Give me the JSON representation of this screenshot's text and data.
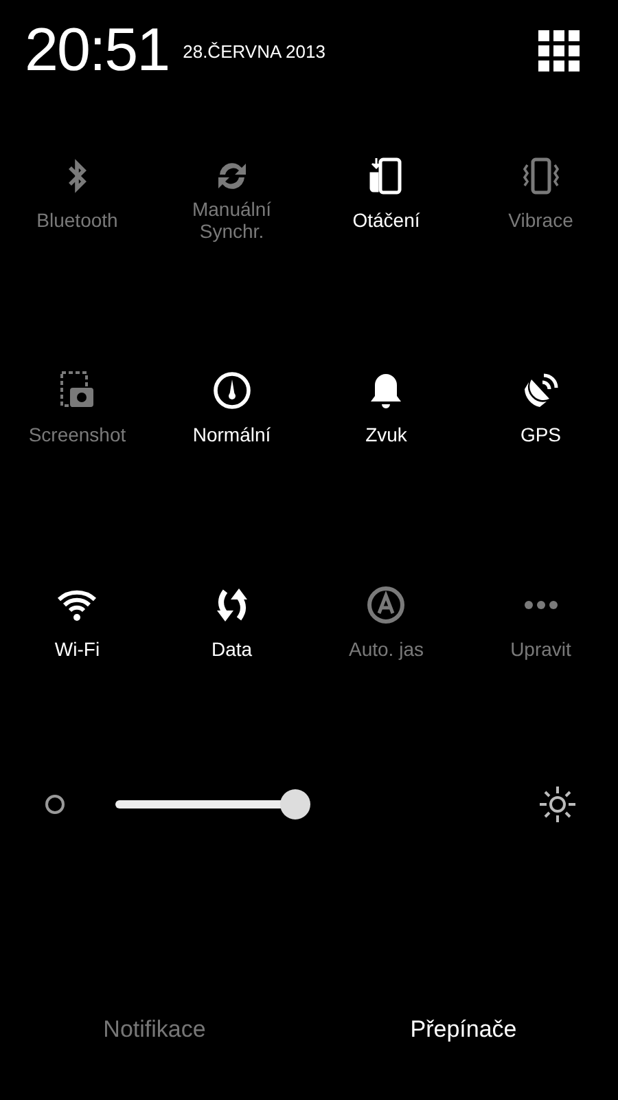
{
  "header": {
    "time": "20:51",
    "date": "28.ČERVNA 2013"
  },
  "toggles": [
    {
      "label": "Bluetooth",
      "on": false
    },
    {
      "label": "Manuální\nSynchr.",
      "on": false
    },
    {
      "label": "Otáčení",
      "on": true
    },
    {
      "label": "Vibrace",
      "on": false
    },
    {
      "label": "Screenshot",
      "on": false
    },
    {
      "label": "Normální",
      "on": true
    },
    {
      "label": "Zvuk",
      "on": true
    },
    {
      "label": "GPS",
      "on": true
    },
    {
      "label": "Wi-Fi",
      "on": true
    },
    {
      "label": "Data",
      "on": true
    },
    {
      "label": "Auto. jas",
      "on": false
    },
    {
      "label": "Upravit",
      "on": false
    }
  ],
  "tabs": [
    {
      "label": "Notifikace",
      "selected": false
    },
    {
      "label": "Přepínače",
      "selected": true
    }
  ]
}
